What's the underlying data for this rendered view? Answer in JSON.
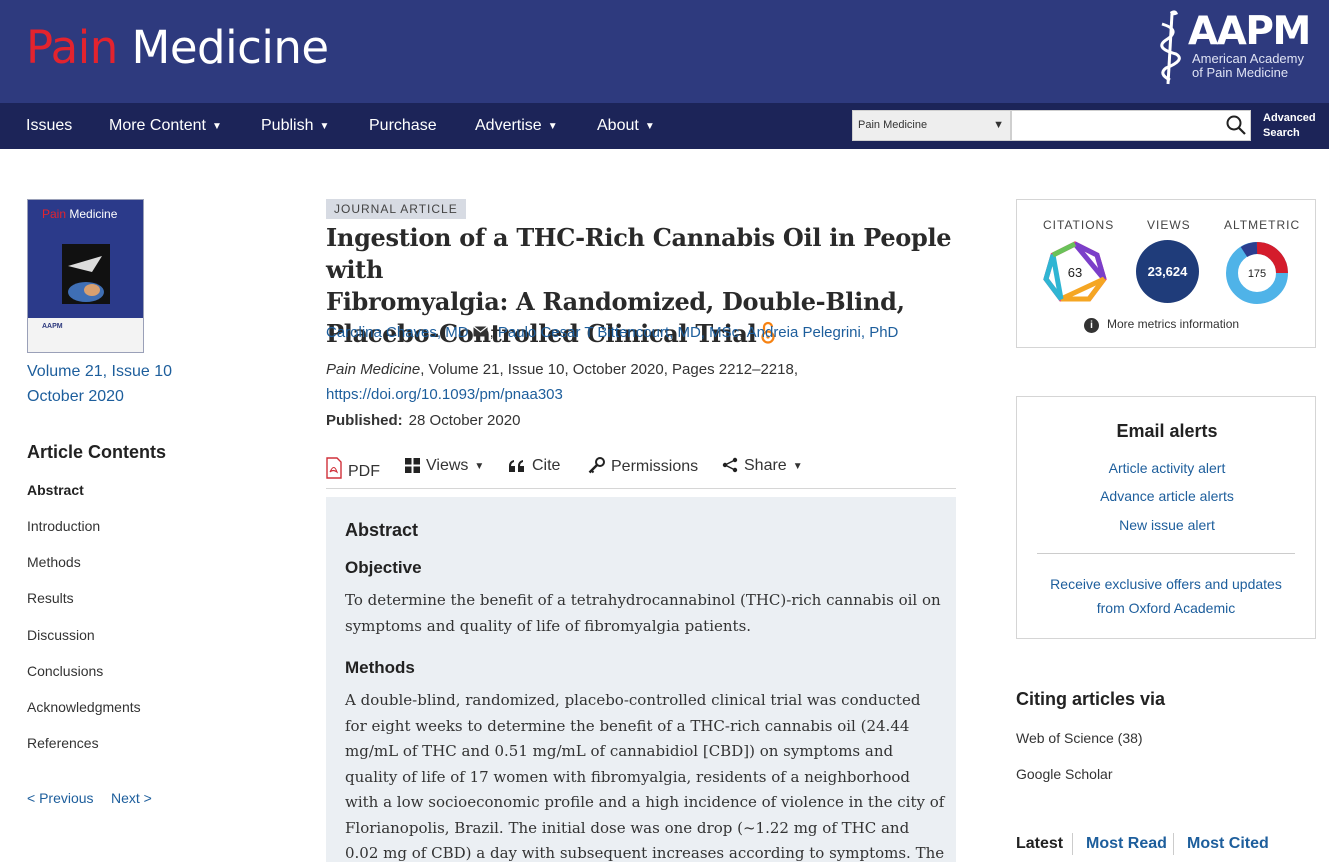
{
  "header": {
    "logo_part1": "Pain",
    "logo_part2": "Medicine",
    "society_logo": "AAPM",
    "society_name_line1": "American Academy",
    "society_name_line2": "of Pain Medicine"
  },
  "nav": {
    "items": [
      "Issues",
      "More Content",
      "Publish",
      "Purchase",
      "Advertise",
      "About"
    ],
    "search_scope": "Pain Medicine",
    "search_placeholder": "",
    "advanced_line1": "Advanced",
    "advanced_line2": "Search"
  },
  "issue": {
    "cover_title_red": "Pain",
    "cover_title_white": "Medicine",
    "volume": "Volume 21, Issue 10",
    "date": "October 2020"
  },
  "contents": {
    "title": "Article Contents",
    "items": [
      "Abstract",
      "Introduction",
      "Methods",
      "Results",
      "Discussion",
      "Conclusions",
      "Acknowledgments",
      "References"
    ],
    "previous": "< Previous",
    "next": "Next >"
  },
  "article": {
    "type": "JOURNAL ARTICLE",
    "title_line1": "Ingestion of a THC-Rich Cannabis Oil in People with",
    "title_line2": "Fibromyalgia: A Randomized, Double-Blind,",
    "title_line3": "Placebo-Controlled Clinical Trial",
    "authors": [
      "Carolina Chaves, MD",
      "Paulo Cesar T Bittencourt, MD, MSc",
      "Andreia Pelegrini, PhD"
    ],
    "journal": "Pain Medicine",
    "citation_rest": ", Volume 21, Issue 10, October 2020, Pages 2212–2218,",
    "doi": "https://doi.org/10.1093/pm/pnaa303",
    "published_label": "Published:",
    "published_date": "28 October 2020"
  },
  "toolbar": {
    "pdf": "PDF",
    "views": "Views",
    "cite": "Cite",
    "permissions": "Permissions",
    "share": "Share"
  },
  "abstract": {
    "heading": "Abstract",
    "objective_heading": "Objective",
    "objective_text": "To determine the benefit of a tetrahydrocannabinol (THC)-rich cannabis oil on symptoms and quality of life of fibromyalgia patients.",
    "methods_heading": "Methods",
    "methods_text": "A double-blind, randomized, placebo-controlled clinical trial was conducted for eight weeks to determine the benefit of a THC-rich cannabis oil (24.44 mg/mL of THC and 0.51 mg/mL of cannabidiol [CBD]) on symptoms and quality of life of 17 women with fibromyalgia, residents of a neighborhood with a low socioeconomic profile and a high incidence of violence in the city of Florianopolis, Brazil. The initial dose was one drop (~1.22 mg of THC and 0.02 mg of CBD) a day with subsequent increases according to symptoms. The"
  },
  "metrics": {
    "citations_label": "CITATIONS",
    "citations_value": "63",
    "views_label": "VIEWS",
    "views_value": "23,624",
    "altmetric_label": "ALTMETRIC",
    "altmetric_value": "175",
    "more_info": "More metrics information"
  },
  "alerts": {
    "title": "Email alerts",
    "links": [
      "Article activity alert",
      "Advance article alerts",
      "New issue alert"
    ],
    "offers": "Receive exclusive offers and updates from Oxford Academic"
  },
  "citing": {
    "title": "Citing articles via",
    "links": [
      "Web of Science (38)",
      "Google Scholar"
    ]
  },
  "tabs": [
    "Latest",
    "Most Read",
    "Most Cited"
  ],
  "colors": {
    "masthead": "#2e3a7e",
    "navbar": "#1c2458",
    "link": "#1d5e9c",
    "logo_red": "#e3232e",
    "abstract_bg": "#ebeff3"
  }
}
